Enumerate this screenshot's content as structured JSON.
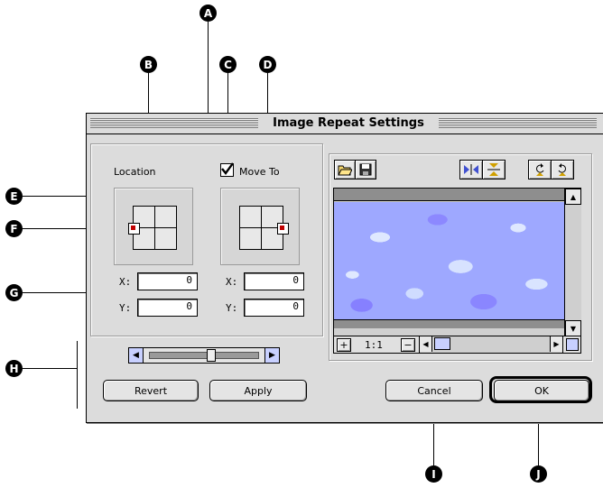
{
  "window": {
    "title": "Image Repeat Settings"
  },
  "location": {
    "label": "Location",
    "x_label": "X:",
    "y_label": "Y:",
    "x_value": "0",
    "y_value": "0"
  },
  "move_to": {
    "label": "Move To",
    "checked": true,
    "x_label": "X:",
    "y_label": "Y:",
    "x_value": "0",
    "y_value": "0"
  },
  "buttons": {
    "revert": "Revert",
    "apply": "Apply",
    "cancel": "Cancel",
    "ok": "OK"
  },
  "preview": {
    "zoom": "1:1",
    "zoom_in": "+",
    "zoom_out": "−"
  },
  "callouts": [
    "A",
    "B",
    "C",
    "D",
    "E",
    "F",
    "G",
    "H",
    "I",
    "J"
  ],
  "icons": {
    "open": "folder-open-icon",
    "save": "floppy-disk-icon",
    "flip_h": "flip-horizontal-icon",
    "flip_v": "flip-vertical-icon",
    "rotate_ccw": "rotate-left-icon",
    "rotate_cw": "rotate-right-icon"
  },
  "colors": {
    "anchor": "#c00000",
    "preview_base": "#9ea8ff"
  }
}
